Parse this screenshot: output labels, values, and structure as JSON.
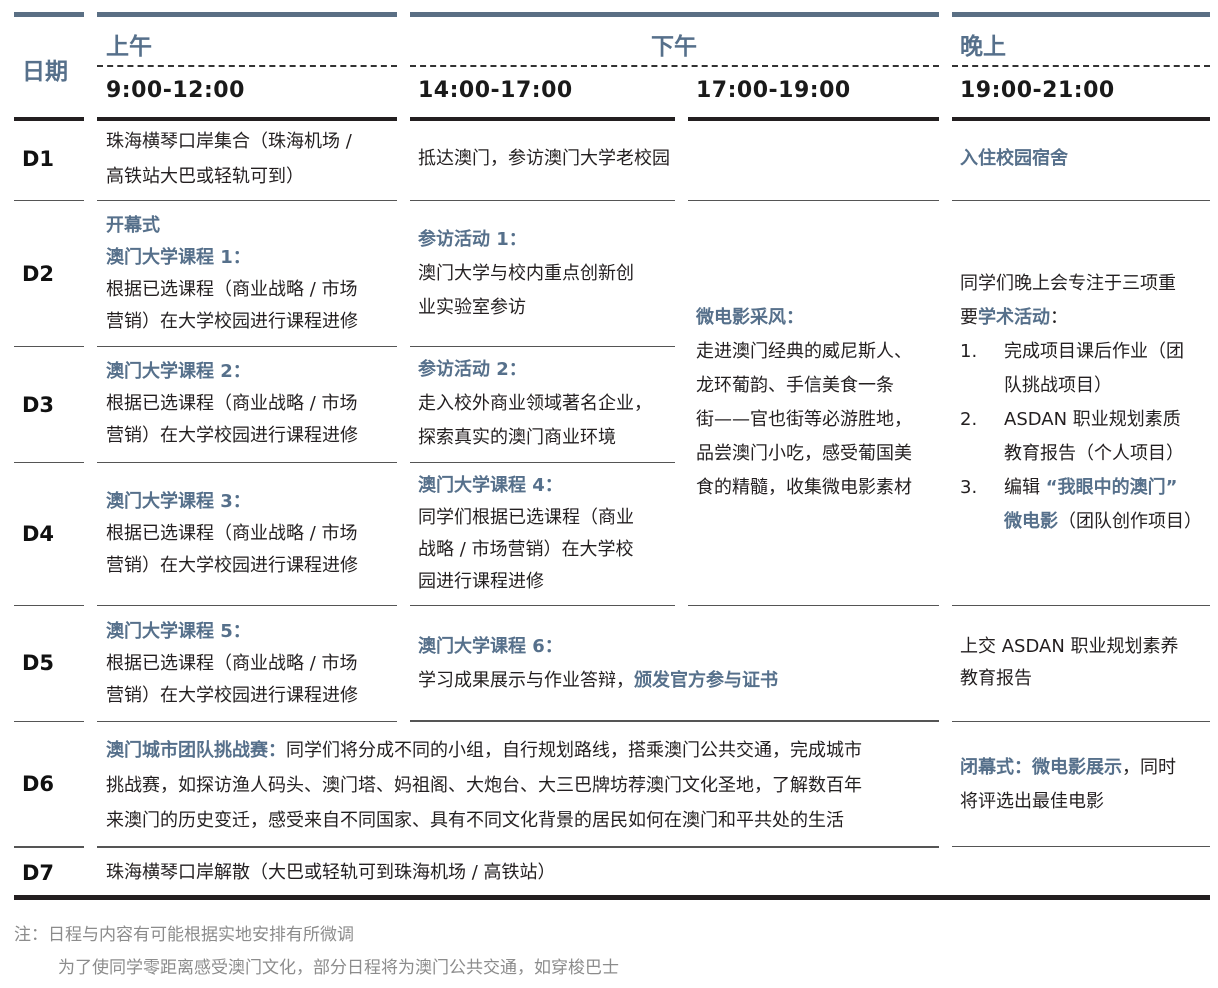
{
  "header": {
    "date_label": "日期",
    "morning": "上午",
    "afternoon": "下午",
    "evening": "晚上",
    "t1": "9:00-12:00",
    "t2": "14:00-17:00",
    "t3": "17:00-19:00",
    "t4": "19:00-21:00"
  },
  "days": {
    "d1": {
      "label": "D1",
      "morning_1": "珠海横琴口岸集合（珠海机场 /",
      "morning_2": "高铁站大巴或轻轨可到）",
      "afternoon": "抵达澳门，参访澳门大学老校园",
      "evening": "入住校园宿舍"
    },
    "d2": {
      "label": "D2",
      "m_title1": "开幕式",
      "m_title2": "澳门大学课程 1：",
      "m_body1": "根据已选课程（商业战略 / 市场",
      "m_body2": "营销）在大学校园进行课程进修",
      "a_title": "参访活动 1：",
      "a_body1": "澳门大学与校内重点创新创",
      "a_body2": "业实验室参访"
    },
    "d3": {
      "label": "D3",
      "m_title": "澳门大学课程 2：",
      "m_body1": "根据已选课程（商业战略 / 市场",
      "m_body2": "营销）在大学校园进行课程进修",
      "a_title": "参访活动 2：",
      "a_body1": "走入校外商业领域著名企业，",
      "a_body2": "探索真实的澳门商业环境"
    },
    "d4": {
      "label": "D4",
      "m_title": "澳门大学课程 3：",
      "m_body1": "根据已选课程（商业战略 / 市场",
      "m_body2": "营销）在大学校园进行课程进修",
      "a_title": "澳门大学课程 4：",
      "a_body1": "同学们根据已选课程（商业",
      "a_body2": "战略 / 市场营销）在大学校",
      "a_body3": "园进行课程进修"
    },
    "d5": {
      "label": "D5",
      "m_title": "澳门大学课程 5：",
      "m_body1": "根据已选课程（商业战略 / 市场",
      "m_body2": "营销）在大学校园进行课程进修",
      "a_title": "澳门大学课程 6：",
      "a_body": "学习成果展示与作业答辩，",
      "a_highlight": "颁发官方参与证书",
      "e_body1": "上交 ASDAN 职业规划素养",
      "e_body2": "教育报告"
    },
    "d6": {
      "label": "D6",
      "title": "澳门城市团队挑战赛：",
      "body1": "同学们将分成不同的小组，自行规划路线，搭乘澳门公共交通，完成城市",
      "body2": "挑战赛，如探访渔人码头、澳门塔、妈祖阁、大炮台、大三巴牌坊荐澳门文化圣地，了解数百年",
      "body3": "来澳门的历史变迁，感受来自不同国家、具有不同文化背景的居民如何在澳门和平共处的生活",
      "e_title": "闭幕式：微电影展示",
      "e_body1": "，同时",
      "e_body2": "将评选出最佳电影"
    },
    "d7": {
      "label": "D7",
      "body": "珠海横琴口岸解散（大巴或轻轨可到珠海机场 / 高铁站）"
    }
  },
  "microfilm": {
    "title": "微电影采风：",
    "l1": "走进澳门经典的威尼斯人、",
    "l2": "龙环葡韵、手信美食一条",
    "l3": "街——官也街等必游胜地，",
    "l4": "品尝澳门小吃，感受葡国美",
    "l5": "食的精髓，收集微电影素材"
  },
  "academic": {
    "intro1": "同学们晚上会专注于三项重",
    "intro2a": "要",
    "intro2b": "学术活动",
    "intro2c": "：",
    "i1_num": "1.",
    "i1_l1": "完成项目课后作业（团",
    "i1_l2": "队挑战项目）",
    "i2_num": "2.",
    "i2_l1": "ASDAN 职业规划素质",
    "i2_l2": "教育报告（个人项目）",
    "i3_num": "3.",
    "i3_l1a": "编辑",
    "i3_l1b": "“我眼中的澳门”",
    "i3_l2a": "微电影",
    "i3_l2b": "（团队创作项目）"
  },
  "notes": {
    "n1": "注：日程与内容有可能根据实地安排有所微调",
    "n2": "为了使同学零距离感受澳门文化，部分日程将为澳门公共交通，如穿梭巴士"
  },
  "colors": {
    "accent": "#56708b",
    "text": "#231f20",
    "note": "#8c8c8c"
  }
}
